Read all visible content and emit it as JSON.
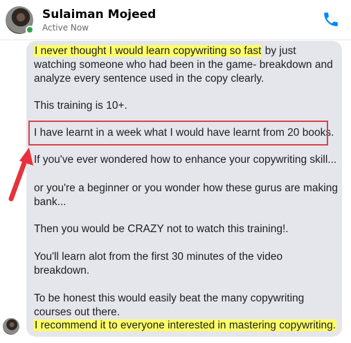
{
  "contact": {
    "name": "Sulaiman Mojeed",
    "status": "Active Now"
  },
  "message": {
    "lines": [
      {
        "pre": "",
        "highlight": "I never thought I would learn copywriting so fast",
        "post": " by just"
      },
      {
        "text": "watching someone who had been in the game- breakdown and"
      },
      {
        "text": "analyze every sentence used in the copy clearly."
      },
      {
        "text": "This training is 10+."
      },
      {
        "text": "I have learnt in a week what I would have learnt from 20 books."
      },
      {
        "text": " If you've ever wondered how to enhance your copywriting skill..."
      },
      {
        "text": "or you're a beginner or you wonder how these gurus are making"
      },
      {
        "text": "bank..."
      },
      {
        "text": "Then you would be CRAZY not to watch this training!."
      },
      {
        "text": "You'll learn alot from the first 30 minutes of the video"
      },
      {
        "text": "breakdown."
      },
      {
        "text": "To be honest this would easily beat the many copywriting"
      },
      {
        "text": "courses out there."
      },
      {
        "highlight": "I recommend it to everyone interested in mastering copywriting."
      }
    ]
  },
  "colors": {
    "highlight": "#ffff66",
    "box_border": "#d9414a",
    "arrow": "#e8313a",
    "bubble": "#e4e6eb",
    "call_icon": "#0084ff",
    "online": "#31a24c"
  },
  "icons": {
    "call": "phone-icon",
    "arrow": "red-arrow-annotation"
  }
}
